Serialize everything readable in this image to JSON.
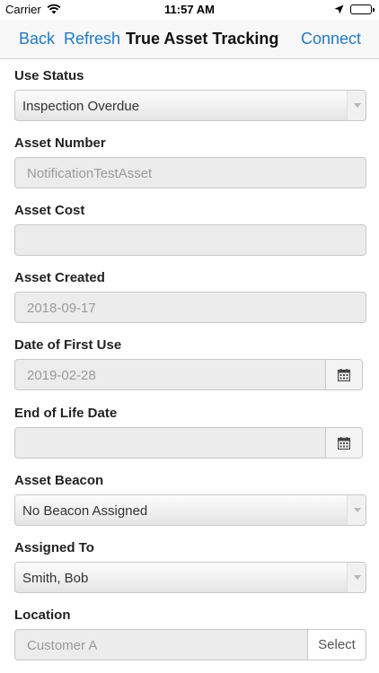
{
  "status_bar": {
    "carrier": "Carrier",
    "time": "11:57 AM"
  },
  "nav": {
    "back": "Back",
    "refresh": "Refresh",
    "title": "True Asset Tracking",
    "connect": "Connect"
  },
  "fields": {
    "use_status": {
      "label": "Use Status",
      "value": "Inspection Overdue"
    },
    "asset_number": {
      "label": "Asset Number",
      "value": "NotificationTestAsset"
    },
    "asset_cost": {
      "label": "Asset Cost",
      "value": ""
    },
    "asset_created": {
      "label": "Asset Created",
      "value": "2018-09-17"
    },
    "date_first_use": {
      "label": "Date of First Use",
      "value": "2019-02-28"
    },
    "end_of_life": {
      "label": "End of Life Date",
      "value": ""
    },
    "asset_beacon": {
      "label": "Asset Beacon",
      "value": "No Beacon Assigned"
    },
    "assigned_to": {
      "label": "Assigned To",
      "value": "Smith, Bob"
    },
    "location": {
      "label": "Location",
      "value": "Customer A",
      "select_label": "Select"
    }
  },
  "icons": {
    "calendar": "calendar-icon",
    "wifi": "wifi-icon",
    "location": "location-arrow-icon",
    "battery": "battery-icon"
  },
  "colors": {
    "accent": "#1a7ad0"
  }
}
